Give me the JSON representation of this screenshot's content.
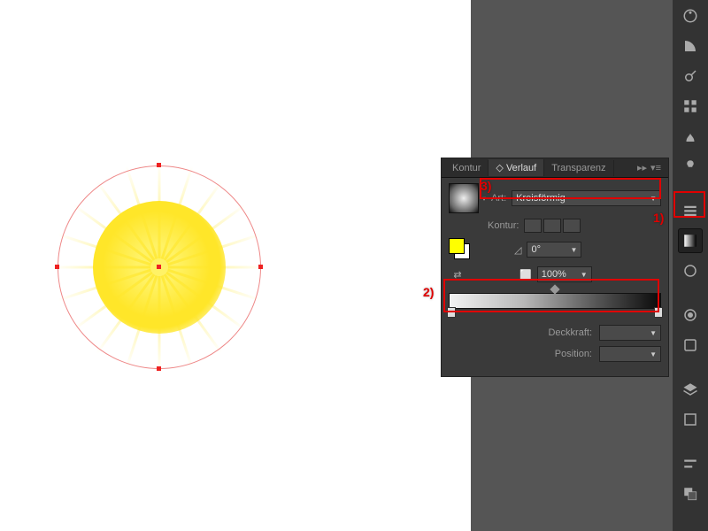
{
  "panel": {
    "tabs": {
      "kontur": "Kontur",
      "verlauf": "Verlauf",
      "transparenz": "Transparenz"
    },
    "type_label": "Art:",
    "type_value": "Kreisförmig",
    "kontur_label": "Kontur:",
    "angle_value": "0°",
    "opacity_value": "100%",
    "deckkraft_label": "Deckkraft:",
    "position_label": "Position:"
  },
  "annotations": {
    "one": "1)",
    "two": "2)",
    "three": "3)"
  },
  "gradient": {
    "stops": [
      {
        "pos": 0,
        "color": "#f2f2f2"
      },
      {
        "pos": 100,
        "color": "#0a0a0a"
      }
    ]
  }
}
